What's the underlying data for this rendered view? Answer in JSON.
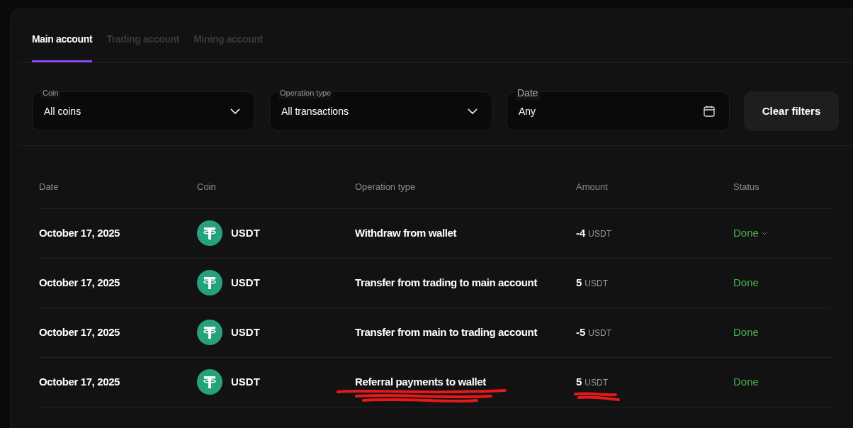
{
  "tabs": [
    {
      "label": "Main account",
      "selected": true
    },
    {
      "label": "Trading account",
      "selected": false
    },
    {
      "label": "Mining account",
      "selected": false
    }
  ],
  "filters": [
    {
      "kind": "select",
      "label": "Coin",
      "value": "All coins"
    },
    {
      "kind": "select",
      "label": "Operation type",
      "value": "All transactions"
    },
    {
      "kind": "date",
      "label": "Date",
      "value": "Any"
    }
  ],
  "clear_button": "Clear filters",
  "table": {
    "columns": [
      "Date",
      "Coin",
      "Operation type",
      "Amount",
      "Status"
    ],
    "rows": [
      {
        "date": "October 17, 2025",
        "coin": "USDT",
        "operation": "Withdraw from wallet",
        "amount": "-4",
        "unit": "USDT",
        "status": "Done",
        "dropdown": true
      },
      {
        "date": "October 17, 2025",
        "coin": "USDT",
        "operation": "Transfer from trading to main account",
        "amount": "5",
        "unit": "USDT",
        "status": "Done",
        "dropdown": false
      },
      {
        "date": "October 17, 2025",
        "coin": "USDT",
        "operation": "Transfer from main to trading account",
        "amount": "-5",
        "unit": "USDT",
        "status": "Done",
        "dropdown": false
      },
      {
        "date": "October 17, 2025",
        "coin": "USDT",
        "operation": "Referral payments to wallet",
        "amount": "5",
        "unit": "USDT",
        "status": "Done",
        "dropdown": false,
        "scribbled": true
      }
    ]
  }
}
